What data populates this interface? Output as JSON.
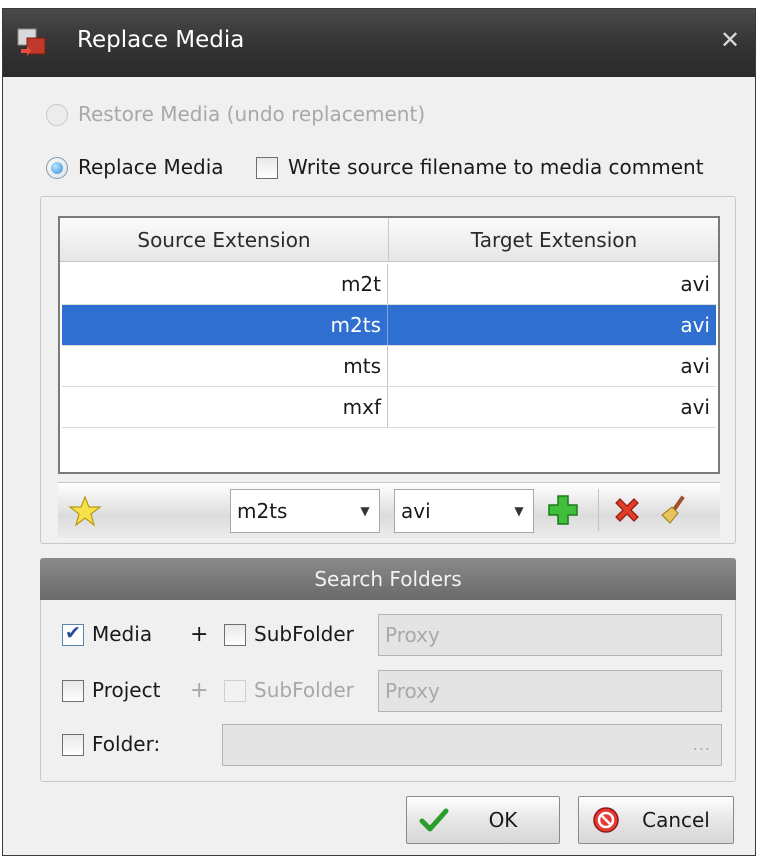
{
  "window": {
    "title": "Replace Media"
  },
  "options": {
    "restore_label": "Restore Media (undo replacement)",
    "replace_label": "Replace Media",
    "write_comment_label": "Write source filename to media comment"
  },
  "grid": {
    "headers": [
      "Source Extension",
      "Target Extension"
    ],
    "rows": [
      {
        "source": "m2t",
        "target": "avi"
      },
      {
        "source": "m2ts",
        "target": "avi"
      },
      {
        "source": "mts",
        "target": "avi"
      },
      {
        "source": "mxf",
        "target": "avi"
      }
    ],
    "selected_row": 1
  },
  "toolbar": {
    "source_value": "m2ts",
    "target_value": "avi"
  },
  "search": {
    "header": "Search Folders",
    "media_label": "Media",
    "project_label": "Project",
    "folder_label": "Folder:",
    "subfolder_label": "SubFolder",
    "plus": "+",
    "proxy_placeholder": "Proxy",
    "folder_ellipsis": "..."
  },
  "buttons": {
    "ok": "OK",
    "cancel": "Cancel"
  },
  "colors": {
    "selection": "#2f6fd0",
    "titlebar": "#333333",
    "group_header": "#7a7a7a"
  }
}
